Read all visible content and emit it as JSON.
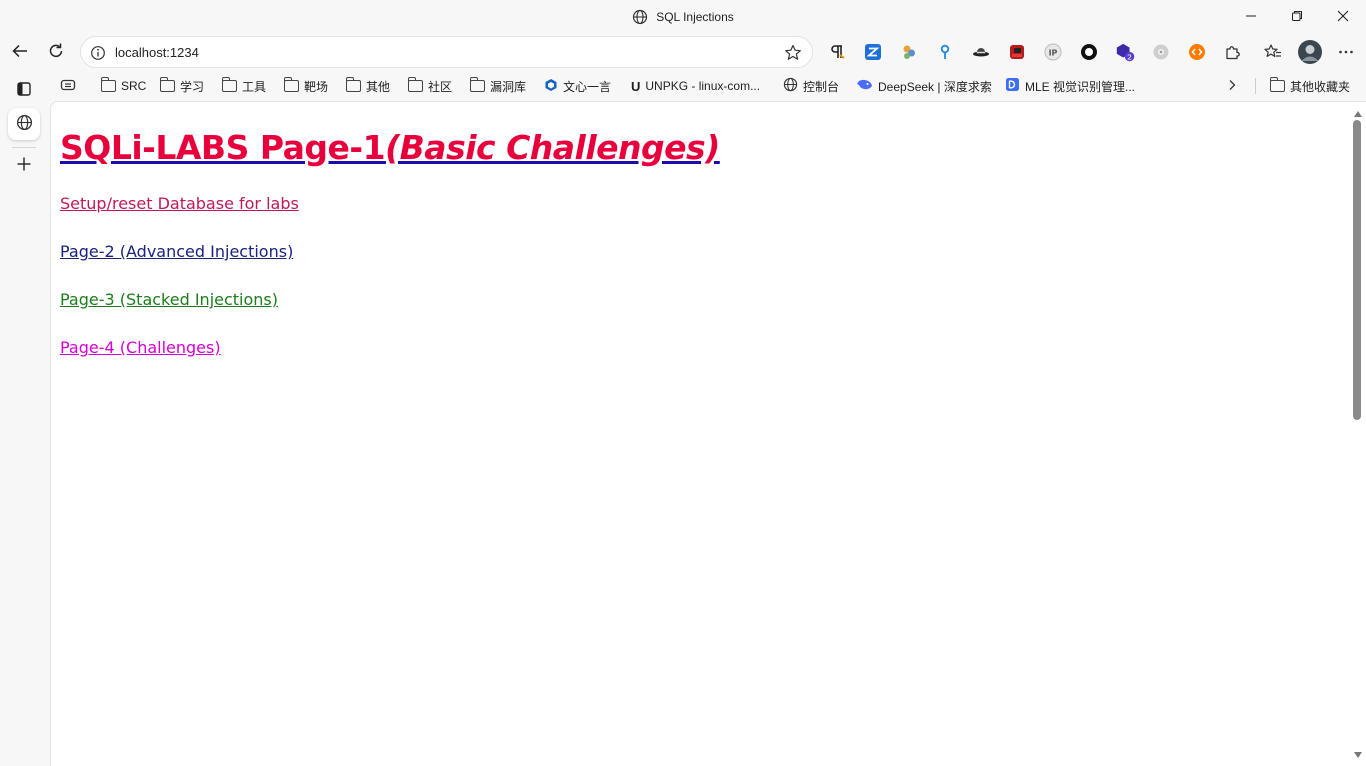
{
  "window": {
    "title": "SQL Injections"
  },
  "toolbar": {
    "url": "localhost:1234"
  },
  "bookmarks": [
    {
      "label": "",
      "icon": "reading-icon"
    },
    {
      "label": "SRC",
      "icon": "folder-icon"
    },
    {
      "label": "学习",
      "icon": "folder-icon"
    },
    {
      "label": "工具",
      "icon": "folder-icon"
    },
    {
      "label": "靶场",
      "icon": "folder-icon"
    },
    {
      "label": "其他",
      "icon": "folder-icon"
    },
    {
      "label": "社区",
      "icon": "folder-icon"
    },
    {
      "label": "漏洞库",
      "icon": "folder-icon"
    },
    {
      "label": "文心一言",
      "icon": "wenxin-icon"
    },
    {
      "label": "UNPKG - linux-com...",
      "icon": "unpkg-icon"
    },
    {
      "label": "控制台",
      "icon": "globe-icon"
    },
    {
      "label": "DeepSeek | 深度求索",
      "icon": "deepseek-icon"
    },
    {
      "label": "MLE 视觉识别管理...",
      "icon": "mle-icon"
    }
  ],
  "other_bookmarks": "其他收藏夹",
  "page": {
    "heading_main": "SQLi-LABS Page-1",
    "heading_sub": "(Basic Challenges)",
    "links": [
      {
        "text": "Setup/reset Database for labs",
        "color": "#c2185b"
      },
      {
        "text": "Page-2 (Advanced Injections)",
        "color": "#1a237e"
      },
      {
        "text": "Page-3 (Stacked Injections)",
        "color": "#1b7d1b"
      },
      {
        "text": "Page-4 (Challenges)",
        "color": "#d500d5"
      }
    ]
  },
  "colors": {
    "heading": "#e8003d",
    "heading_underline": "#1a0dab"
  }
}
